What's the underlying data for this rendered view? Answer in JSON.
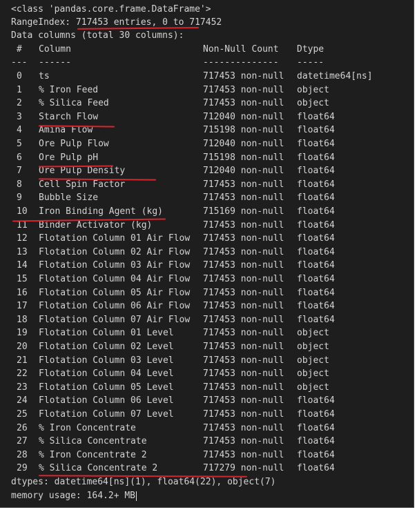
{
  "header": {
    "class_line": "<class 'pandas.core.frame.DataFrame'>",
    "range_index": "RangeIndex: 717453 entries, 0 to 717452",
    "data_columns": "Data columns (total 30 columns):"
  },
  "table": {
    "headers": [
      "#",
      "Column",
      "Non-Null Count",
      "Dtype"
    ],
    "separators": [
      "---",
      "------",
      "--------------",
      "-----"
    ],
    "rows": [
      {
        "idx": "0",
        "column": "ts",
        "count": "717453 non-null",
        "dtype": "datetime64[ns]"
      },
      {
        "idx": "1",
        "column": "% Iron Feed",
        "count": "717453 non-null",
        "dtype": "object"
      },
      {
        "idx": "2",
        "column": "% Silica Feed",
        "count": "717453 non-null",
        "dtype": "object"
      },
      {
        "idx": "3",
        "column": "Starch Flow",
        "count": "712040 non-null",
        "dtype": "float64"
      },
      {
        "idx": "4",
        "column": "Amina Flow",
        "count": "715198 non-null",
        "dtype": "float64"
      },
      {
        "idx": "5",
        "column": "Ore Pulp Flow",
        "count": "712040 non-null",
        "dtype": "float64"
      },
      {
        "idx": "6",
        "column": "Ore Pulp pH",
        "count": "715198 non-null",
        "dtype": "float64"
      },
      {
        "idx": "7",
        "column": "Ore Pulp Density",
        "count": "712040 non-null",
        "dtype": "float64"
      },
      {
        "idx": "8",
        "column": "Cell Spin Factor",
        "count": "717453 non-null",
        "dtype": "float64"
      },
      {
        "idx": "9",
        "column": "Bubble Size",
        "count": "717453 non-null",
        "dtype": "float64"
      },
      {
        "idx": "10",
        "column": "Iron Binding Agent (kg)",
        "count": "715169 non-null",
        "dtype": "float64"
      },
      {
        "idx": "11",
        "column": "Binder Activator (kg)",
        "count": "717453 non-null",
        "dtype": "float64"
      },
      {
        "idx": "12",
        "column": "Flotation Column 01 Air Flow",
        "count": "717453 non-null",
        "dtype": "float64"
      },
      {
        "idx": "13",
        "column": "Flotation Column 02 Air Flow",
        "count": "717453 non-null",
        "dtype": "float64"
      },
      {
        "idx": "14",
        "column": "Flotation Column 03 Air Flow",
        "count": "717453 non-null",
        "dtype": "float64"
      },
      {
        "idx": "15",
        "column": "Flotation Column 04 Air Flow",
        "count": "717453 non-null",
        "dtype": "float64"
      },
      {
        "idx": "16",
        "column": "Flotation Column 05 Air Flow",
        "count": "717453 non-null",
        "dtype": "float64"
      },
      {
        "idx": "17",
        "column": "Flotation Column 06 Air Flow",
        "count": "717453 non-null",
        "dtype": "float64"
      },
      {
        "idx": "18",
        "column": "Flotation Column 07 Air Flow",
        "count": "717453 non-null",
        "dtype": "float64"
      },
      {
        "idx": "19",
        "column": "Flotation Column 01 Level",
        "count": "717453 non-null",
        "dtype": "object"
      },
      {
        "idx": "20",
        "column": "Flotation Column 02 Level",
        "count": "717453 non-null",
        "dtype": "object"
      },
      {
        "idx": "21",
        "column": "Flotation Column 03 Level",
        "count": "717453 non-null",
        "dtype": "object"
      },
      {
        "idx": "22",
        "column": "Flotation Column 04 Level",
        "count": "717453 non-null",
        "dtype": "object"
      },
      {
        "idx": "23",
        "column": "Flotation Column 05 Level",
        "count": "717453 non-null",
        "dtype": "object"
      },
      {
        "idx": "24",
        "column": "Flotation Column 06 Level",
        "count": "717453 non-null",
        "dtype": "float64"
      },
      {
        "idx": "25",
        "column": "Flotation Column 07 Level",
        "count": "717453 non-null",
        "dtype": "float64"
      },
      {
        "idx": "26",
        "column": "% Iron Concentrate",
        "count": "717453 non-null",
        "dtype": "float64"
      },
      {
        "idx": "27",
        "column": "% Silica Concentrate",
        "count": "717453 non-null",
        "dtype": "float64"
      },
      {
        "idx": "28",
        "column": "% Iron Concentrate 2",
        "count": "717453 non-null",
        "dtype": "float64"
      },
      {
        "idx": "29",
        "column": "% Silica Concentrate 2",
        "count": "717279 non-null",
        "dtype": "float64"
      }
    ]
  },
  "footer": {
    "dtypes": "dtypes: datetime64[ns](1), float64(22), object(7)",
    "memory": "memory usage: 164.2+ MB"
  },
  "annotations": {
    "underline_color": "#d7262f",
    "underlined_rows": [
      3,
      6,
      7,
      10,
      29
    ]
  }
}
